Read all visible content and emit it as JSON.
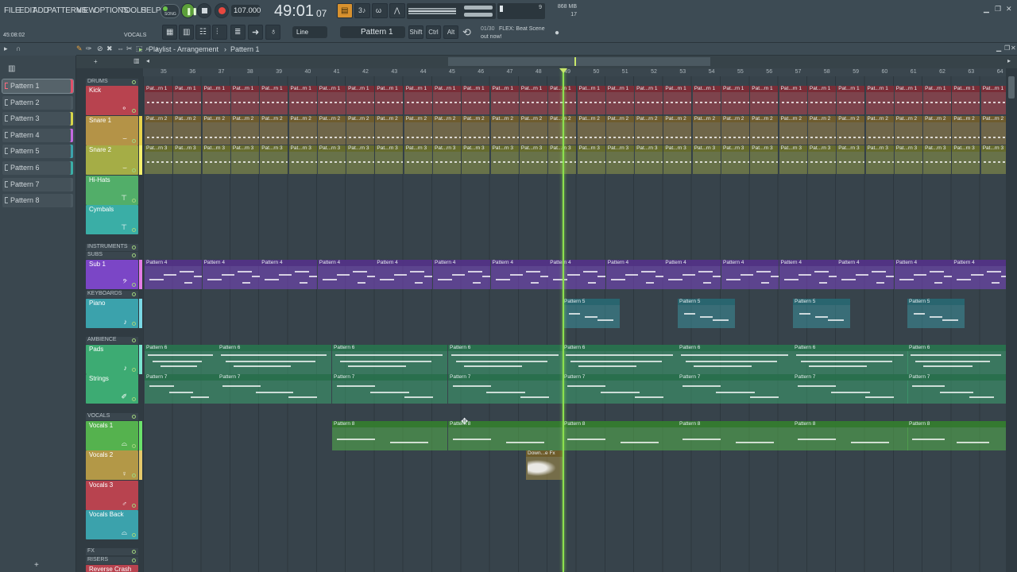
{
  "menu": [
    "FILE",
    "EDIT",
    "ADD",
    "PATTERNS",
    "VIEW",
    "OPTIONS",
    "TOOLS",
    "HELP"
  ],
  "transport": {
    "mode": "SONG",
    "tempo": "107.000",
    "time_main": "49:01",
    "time_sub": "07",
    "hint_small": "45:08:02",
    "hint_label": "VOCALS",
    "cpu": "9",
    "ram": "868 MB",
    "poly": "17"
  },
  "toolbar": {
    "snap": "Line",
    "pattern_selector": "Pattern 1",
    "shift": "Shift",
    "ctrl": "Ctrl",
    "alt": "Alt",
    "news_count": "01/30",
    "news_text": "FLEX: Beat Scene",
    "news_sub": "out now!"
  },
  "playlist": {
    "breadcrumb": "Playlist - Arrangement",
    "sep": "›",
    "current_pattern": "Pattern 1"
  },
  "patterns": [
    "Pattern 1",
    "Pattern 2",
    "Pattern 3",
    "Pattern 4",
    "Pattern 5",
    "Pattern 6",
    "Pattern 7",
    "Pattern 8"
  ],
  "ruler_bars": [
    "35",
    "36",
    "37",
    "38",
    "39",
    "40",
    "41",
    "42",
    "43",
    "44",
    "45",
    "46",
    "47",
    "48",
    "49",
    "50",
    "51",
    "52",
    "53",
    "54",
    "55",
    "56",
    "57",
    "58",
    "59",
    "60",
    "61",
    "62",
    "63",
    "64"
  ],
  "groups": {
    "drums": "DRUMS",
    "instruments": "INSTRUMENTS",
    "subs": "SUBS",
    "keyboards": "KEYBOARDS",
    "ambience": "AMBIENCE",
    "vocals": "VOCALS",
    "fx": "FX",
    "risers": "RISERS"
  },
  "tracks": [
    {
      "name": "Kick",
      "color": "#b8434f"
    },
    {
      "name": "Snare 1",
      "color": "#b49347"
    },
    {
      "name": "Snare 2",
      "color": "#a5ad46"
    },
    {
      "name": "Hi-Hats",
      "color": "#52ae69"
    },
    {
      "name": "Cymbals",
      "color": "#3aaea6"
    },
    {
      "name": "Sub 1",
      "color": "#7b46c6"
    },
    {
      "name": "Piano",
      "color": "#3ba2ac"
    },
    {
      "name": "Pads",
      "color": "#3dab73"
    },
    {
      "name": "Strings",
      "color": "#3dab73"
    },
    {
      "name": "Vocals 1",
      "color": "#55b24e"
    },
    {
      "name": "Vocals 2",
      "color": "#b39847"
    },
    {
      "name": "Vocals 3",
      "color": "#b8434f"
    },
    {
      "name": "Vocals Back",
      "color": "#3ba2ac"
    },
    {
      "name": "Reverse Crash",
      "color": "#b8434f"
    }
  ],
  "clip_labels": {
    "kick": "Pat...rn 1",
    "snare1": "Pat...rn 2",
    "snare2": "Pat...rn 3",
    "sub": "Pattern 4",
    "piano": "Pattern 5",
    "pads": "Pattern 6",
    "strings": "Pattern 7",
    "vocals": "Pattern 8",
    "audio": "Down...e Fx"
  },
  "colors": {
    "accent": "#8be04e",
    "record": "#e8483f",
    "song": "#6cc24a"
  },
  "icons": [
    "play-icon",
    "stop-icon",
    "record-icon",
    "pencil-icon",
    "magnet-icon",
    "slice-icon",
    "zoom-icon",
    "speaker-icon",
    "globe-icon"
  ]
}
